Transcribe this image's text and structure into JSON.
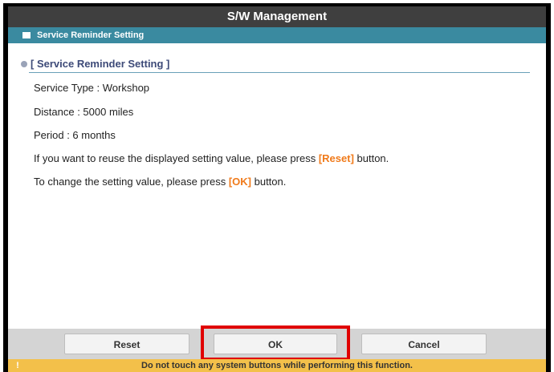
{
  "window": {
    "title": "S/W Management"
  },
  "subheader": {
    "label": "Service Reminder Setting"
  },
  "section": {
    "title": "[ Service Reminder Setting ]"
  },
  "info": {
    "service_type": "Service Type : Workshop",
    "distance": "Distance : 5000 miles",
    "period": "Period : 6 months",
    "reuse_prefix": "If you want to reuse the displayed setting value, please press ",
    "reuse_keyword": "[Reset]",
    "reuse_suffix": " button.",
    "change_prefix": "To change the setting value, please press ",
    "change_keyword": "[OK]",
    "change_suffix": " button."
  },
  "buttons": {
    "reset": "Reset",
    "ok": "OK",
    "cancel": "Cancel"
  },
  "warning": {
    "icon": "!",
    "text": "Do not touch any system buttons while performing this function."
  },
  "colors": {
    "highlight": "#f07a1a",
    "header": "#3a8aa0",
    "warning": "#f3c04a",
    "ok_outline": "#e00000"
  }
}
